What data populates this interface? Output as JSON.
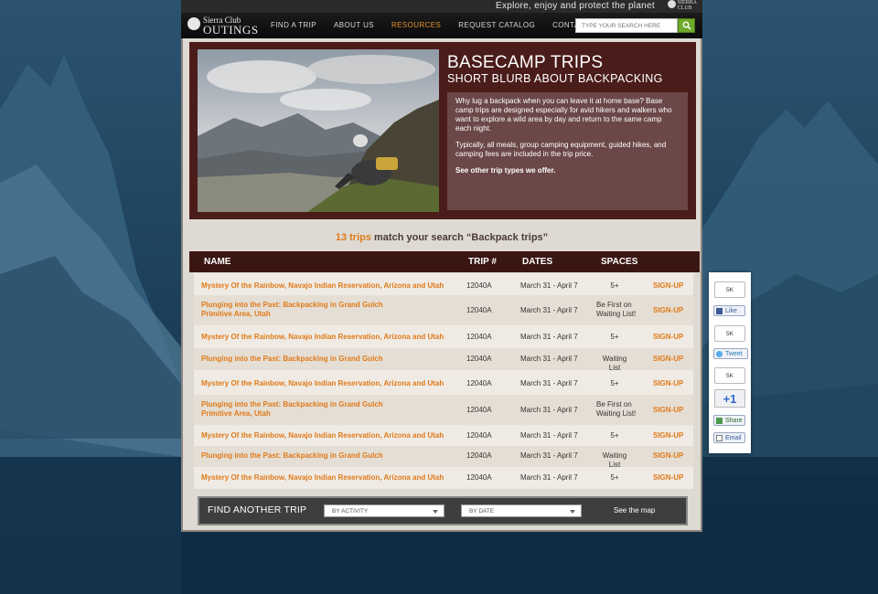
{
  "header": {
    "tagline": "Explore, enjoy and protect the planet",
    "mini_logo": [
      "SIERRA",
      "CLUB"
    ],
    "logo_line1": "Sierra Club",
    "logo_line2": "OUTINGS"
  },
  "nav": {
    "items": [
      {
        "label": "FIND A TRIP",
        "active": false
      },
      {
        "label": "ABOUT US",
        "active": false
      },
      {
        "label": "RESOURCES",
        "active": true
      },
      {
        "label": "REQUEST CATALOG",
        "active": false
      },
      {
        "label": "CONTACT US",
        "active": false
      }
    ],
    "search_placeholder": "TYPE YOUR SEARCH HERE"
  },
  "hero": {
    "title": "BASECAMP TRIPS",
    "subtitle": "SHORT BLURB ABOUT BACKPACKING",
    "para1": "Why lug a backpack when you can leave it at home base? Base camp trips are designed especially for avid hikers and walkers who want to explore a wild area by day and return to the same camp each night.",
    "para2": "Typically, all meals, group camping equipment, guided hikes, and camping fees are included in the trip price.",
    "link": "See other trip types we offer."
  },
  "results": {
    "count": "13 trips",
    "text": " match your search “Backpack trips”"
  },
  "table": {
    "headers": {
      "name": "NAME",
      "trip": "TRIP #",
      "dates": "DATES",
      "spaces": "SPACES"
    },
    "rows": [
      {
        "name": "Mystery Of the Rainbow, Navajo Indian Reservation, Arizona and Utah",
        "trip": "12040A",
        "dates": "March 31 - April 7",
        "spaces": "5+",
        "signup": "SIGN-UP"
      },
      {
        "name": "Plunging into the Past: Backpacking in Grand Gulch Primitive Area, Utah",
        "trip": "12040A",
        "dates": "March 31 - April 7",
        "spaces": "Be First on Waiting List!",
        "signup": "SIGN-UP"
      },
      {
        "name": "Mystery Of the Rainbow, Navajo Indian Reservation, Arizona and Utah",
        "trip": "12040A",
        "dates": "March 31 - April 7",
        "spaces": "5+",
        "signup": "SIGN-UP"
      },
      {
        "name": "Plunging into the Past: Backpacking in Grand Gulch",
        "trip": "12040A",
        "dates": "March 31 - April 7",
        "spaces": "Waiting List",
        "signup": "SIGN-UP"
      },
      {
        "name": "Mystery Of the Rainbow, Navajo Indian Reservation, Arizona and Utah",
        "trip": "12040A",
        "dates": "March 31 - April 7",
        "spaces": "5+",
        "signup": "SIGN-UP"
      },
      {
        "name": "Plunging into the Past: Backpacking in Grand Gulch Primitive Area, Utah",
        "trip": "12040A",
        "dates": "March 31 - April 7",
        "spaces": "Be First on Waiting List!",
        "signup": "SIGN-UP"
      },
      {
        "name": "Mystery Of the Rainbow, Navajo Indian Reservation, Arizona and Utah",
        "trip": "12040A",
        "dates": "March 31 - April 7",
        "spaces": "5+",
        "signup": "SIGN-UP"
      },
      {
        "name": "Plunging into the Past: Backpacking in Grand Gulch",
        "trip": "12040A",
        "dates": "March 31 - April 7",
        "spaces": "Waiting List",
        "signup": "SIGN-UP"
      },
      {
        "name": "Mystery Of the Rainbow, Navajo Indian Reservation, Arizona and Utah",
        "trip": "12040A",
        "dates": "March 31 - April 7",
        "spaces": "5+",
        "signup": "SIGN-UP"
      }
    ]
  },
  "finder": {
    "label": "FIND ANOTHER TRIP",
    "activity": "BY ACTIVITY",
    "date": "BY DATE",
    "map": "See the map"
  },
  "social": {
    "like_count": "5K",
    "like": "Like",
    "tweet_count": "5K",
    "tweet": "Tweet",
    "plus_count": "5K",
    "plus": "+1",
    "share": "Share",
    "email": "Email"
  },
  "colors": {
    "accent": "#e07a1a",
    "hero_bg": "#4a1c1a",
    "page_bg": "#0f2e45"
  }
}
